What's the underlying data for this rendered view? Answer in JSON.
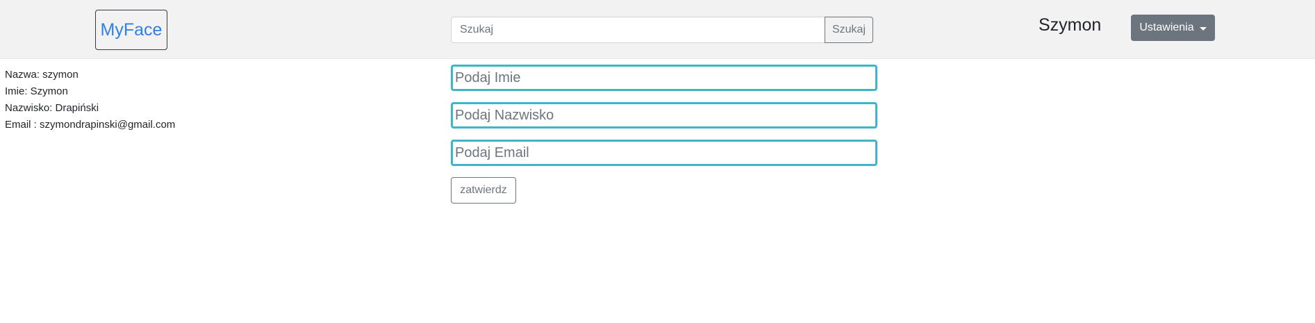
{
  "navbar": {
    "brand": "MyFace",
    "search": {
      "placeholder": "Szukaj",
      "value": "",
      "button_label": "Szukaj"
    },
    "username": "Szymon",
    "settings_label": "Ustawienia",
    "settings_icon": "caret-down-icon"
  },
  "profile": {
    "lines": [
      "Nazwa: szymon",
      "Imie: Szymon",
      "Nazwisko: Drapiński",
      "Email : szymondrapinski@gmail.com"
    ]
  },
  "form": {
    "first_name": {
      "placeholder": "Podaj Imie",
      "value": ""
    },
    "last_name": {
      "placeholder": "Podaj Nazwisko",
      "value": ""
    },
    "email": {
      "placeholder": "Podaj Email",
      "value": ""
    },
    "submit_label": "zatwierdz"
  },
  "colors": {
    "navbar_bg": "#f2f2f2",
    "brand": "#2f7fe6",
    "settings_bg": "#6c757d",
    "input_focus_border": "#3fb5c8"
  }
}
